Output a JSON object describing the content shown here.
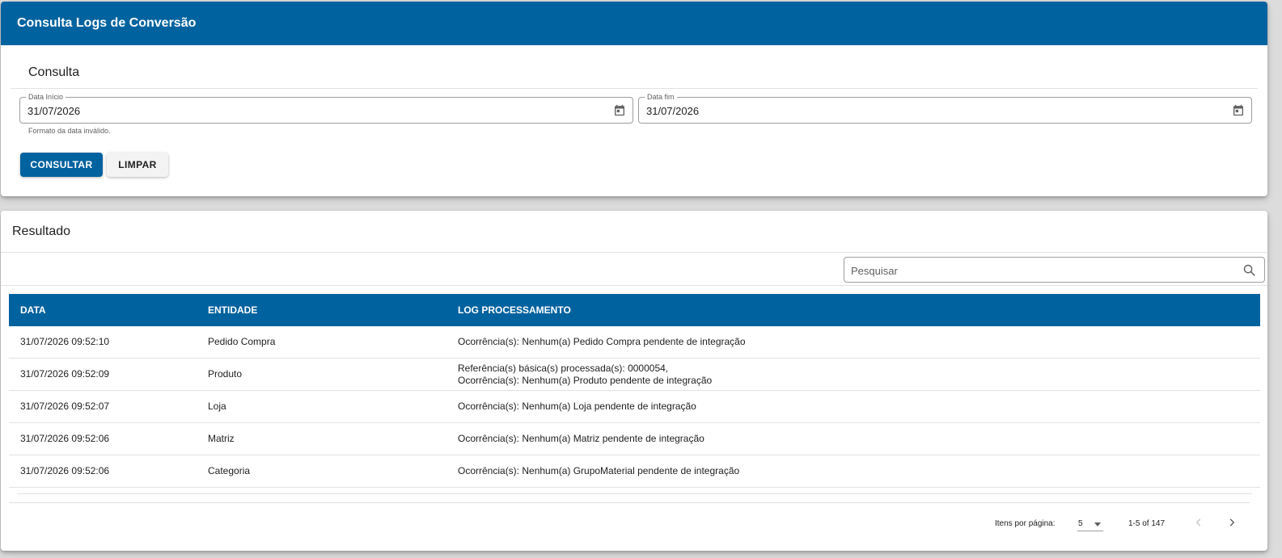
{
  "header": {
    "title": "Consulta Logs de Conversão"
  },
  "query": {
    "section_title": "Consulta",
    "start_date": {
      "label": "Data Início",
      "value": "31/07/2026",
      "hint": "Formato da data inválido."
    },
    "end_date": {
      "label": "Data fim",
      "value": "31/07/2026"
    },
    "consult_label": "CONSULTAR",
    "clear_label": "LIMPAR"
  },
  "results": {
    "section_title": "Resultado",
    "search_placeholder": "Pesquisar",
    "columns": [
      "DATA",
      "ENTIDADE",
      "LOG PROCESSAMENTO"
    ],
    "rows": [
      {
        "data": "31/07/2026 09:52:10",
        "entidade": "Pedido Compra",
        "log": [
          "Ocorrência(s): Nenhum(a) Pedido Compra pendente de integração"
        ]
      },
      {
        "data": "31/07/2026 09:52:09",
        "entidade": "Produto",
        "log": [
          "Referência(s) básica(s) processada(s): 0000054,",
          "Ocorrência(s): Nenhum(a) Produto pendente de integração"
        ]
      },
      {
        "data": "31/07/2026 09:52:07",
        "entidade": "Loja",
        "log": [
          "Ocorrência(s): Nenhum(a) Loja pendente de integração"
        ]
      },
      {
        "data": "31/07/2026 09:52:06",
        "entidade": "Matriz",
        "log": [
          "Ocorrência(s): Nenhum(a) Matriz pendente de integração"
        ]
      },
      {
        "data": "31/07/2026 09:52:06",
        "entidade": "Categoria",
        "log": [
          "Ocorrência(s): Nenhum(a) GrupoMaterial pendente de integração"
        ]
      }
    ],
    "paginator": {
      "items_per_page_label": "Itens por página:",
      "page_size": "5",
      "range": "1-5 of 147"
    }
  },
  "icons": {
    "calendar": "calendar-icon",
    "search": "search-icon",
    "prev": "chevron-left-icon",
    "next": "chevron-right-icon"
  },
  "colors": {
    "primary": "#00629f",
    "background": "#dcdcdc"
  }
}
